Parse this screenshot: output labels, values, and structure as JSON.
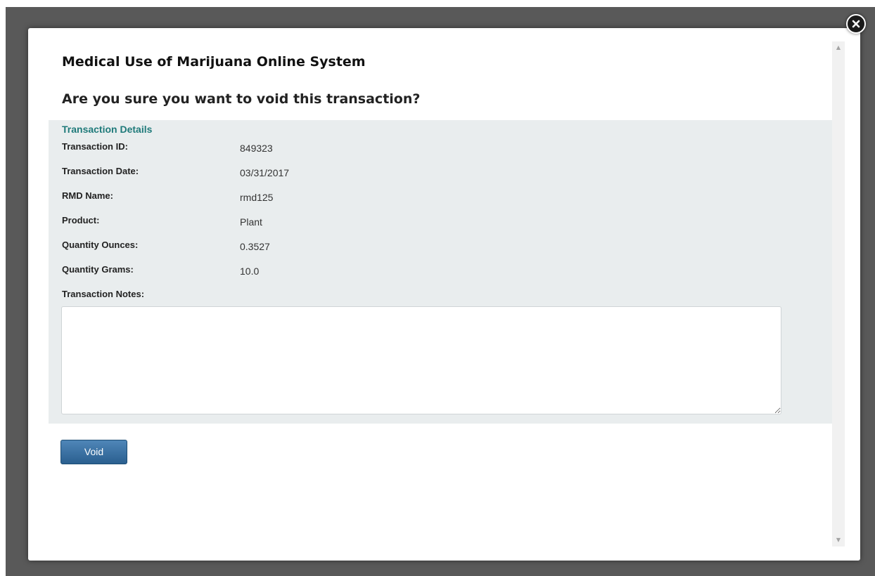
{
  "dialog": {
    "app_title": "Medical Use of Marijuana Online System",
    "question": "Are you sure you want to void this transaction?"
  },
  "details": {
    "section_title": "Transaction Details",
    "fields": [
      {
        "label": "Transaction ID:",
        "value": "849323"
      },
      {
        "label": "Transaction Date:",
        "value": "03/31/2017"
      },
      {
        "label": "RMD Name:",
        "value": "rmd125"
      },
      {
        "label": "Product:",
        "value": "Plant"
      },
      {
        "label": "Quantity Ounces:",
        "value": "0.3527"
      },
      {
        "label": "Quantity Grams:",
        "value": "10.0"
      }
    ],
    "notes_label": "Transaction Notes:",
    "notes_value": ""
  },
  "actions": {
    "void_label": "Void"
  },
  "icons": {
    "close": "close-icon",
    "scroll_up": "scroll-up-arrow-icon",
    "scroll_down": "scroll-down-arrow-icon"
  },
  "colors": {
    "overlay": "#595959",
    "panel_background": "#e9edee",
    "section_title": "#1f7a7a",
    "button_primary": "#2a5f8f"
  }
}
